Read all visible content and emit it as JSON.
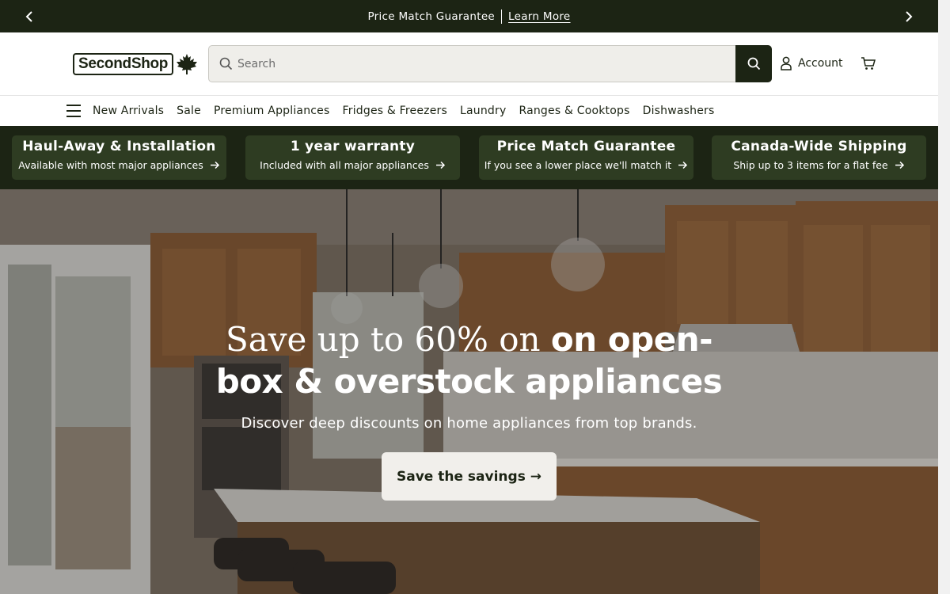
{
  "announcement": {
    "text": "Price Match Guarantee",
    "link": "Learn More",
    "prev_icon": "chevron-left-icon",
    "next_icon": "chevron-right-icon"
  },
  "header": {
    "logo_text": "SecondShop",
    "logo_icon": "maple-leaf-icon",
    "search_placeholder": "Search",
    "account_label": "Account",
    "cart_icon": "cart-icon"
  },
  "nav": {
    "menu_icon": "hamburger-menu-icon",
    "items": [
      "New Arrivals",
      "Sale",
      "Premium Appliances",
      "Fridges & Freezers",
      "Laundry",
      "Ranges & Cooktops",
      "Dishwashers"
    ]
  },
  "promos": [
    {
      "title": "Haul-Away & Installation",
      "subtitle": "Available with most major appliances"
    },
    {
      "title": "1 year warranty",
      "subtitle": "Included with all major appliances"
    },
    {
      "title": "Price Match Guarantee",
      "subtitle": "If you see a lower place we'll match it"
    },
    {
      "title": "Canada-Wide Shipping",
      "subtitle": "Ship up to 3 items for a flat fee"
    }
  ],
  "hero": {
    "title_serif": "Save up to 60% on",
    "title_bold_1": "on open-",
    "title_bold_2": "box & overstock appliances",
    "subtitle": "Discover deep discounts on home appliances from top brands.",
    "cta": "Save the savings →"
  },
  "colors": {
    "brand_dark": "#1c2414",
    "promo_tile": "#2e3c22",
    "search_bg": "#efeeea"
  }
}
